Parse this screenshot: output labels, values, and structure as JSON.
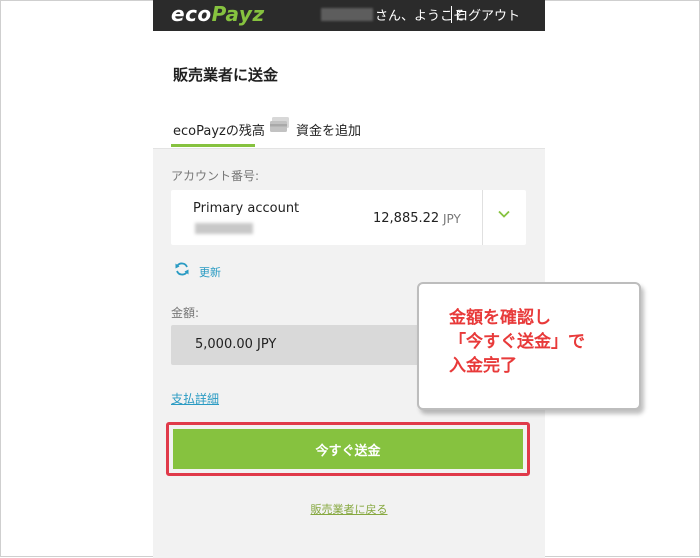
{
  "header": {
    "logo_eco": "eco",
    "logo_payz": "Payz",
    "welcome_text": "さん、ようこそ",
    "logout_label": "ログアウト"
  },
  "page": {
    "title": "販売業者に送金"
  },
  "tabs": {
    "balance_label": "ecoPayzの残高",
    "add_funds_label": "資金を追加"
  },
  "account": {
    "label": "アカウント番号:",
    "name": "Primary account",
    "balance": "12,885.22",
    "currency": "JPY"
  },
  "refresh": {
    "label": "更新"
  },
  "amount": {
    "label": "金額:",
    "value": "5,000.00 JPY"
  },
  "links": {
    "payment_details": "支払詳細",
    "back_to_merchant": "販売業者に戻る"
  },
  "send_button": {
    "label": "今すぐ送金"
  },
  "callout": {
    "lines": [
      "金額を確認し",
      "「今すぐ送金」で",
      "入金完了"
    ]
  },
  "colors": {
    "accent_green": "#86c23f",
    "highlight_red": "#e03a4a",
    "link_blue": "#2a9bc3"
  }
}
